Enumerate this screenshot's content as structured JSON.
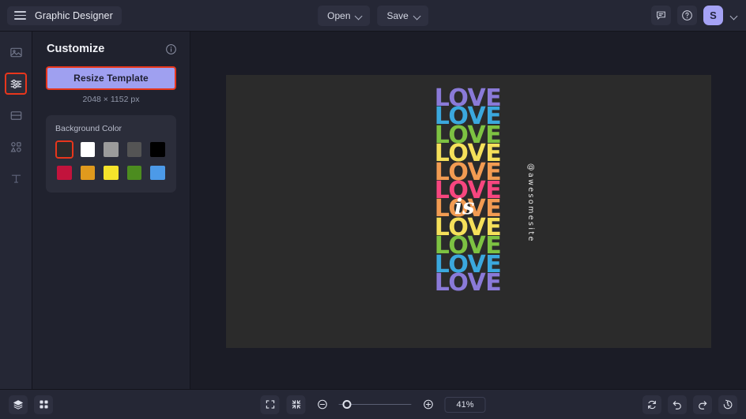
{
  "header": {
    "brand_title": "Graphic Designer",
    "menu_icon": "hamburger-icon",
    "open_label": "Open",
    "save_label": "Save",
    "comment_icon": "comment-icon",
    "help_icon": "help-circle-icon",
    "avatar_initial": "S",
    "avatar_chevron": "chevron-down-icon"
  },
  "rail": {
    "items": [
      {
        "icon": "image-icon",
        "active": false
      },
      {
        "icon": "sliders-icon",
        "active": true
      },
      {
        "icon": "template-layout-icon",
        "active": false
      },
      {
        "icon": "shapes-icon",
        "active": false
      },
      {
        "icon": "text-icon",
        "active": false
      }
    ]
  },
  "panel": {
    "title": "Customize",
    "info_icon": "info-circle-icon",
    "resize_label": "Resize Template",
    "dimensions": "2048 × 1152 px",
    "background_color": {
      "label": "Background Color",
      "swatches": [
        {
          "hex": "#2b2b2b",
          "selected": true
        },
        {
          "hex": "#ffffff",
          "selected": false
        },
        {
          "hex": "#9b9b9b",
          "selected": false
        },
        {
          "hex": "#545454",
          "selected": false
        },
        {
          "hex": "#000000",
          "selected": false
        },
        {
          "hex": "#c2133c",
          "selected": false
        },
        {
          "hex": "#e09a1d",
          "selected": false
        },
        {
          "hex": "#f5e32b",
          "selected": false
        },
        {
          "hex": "#4c8c1f",
          "selected": false
        },
        {
          "hex": "#4c9ae8",
          "selected": false
        }
      ]
    }
  },
  "canvas": {
    "artboard_background": "#2b2b2b",
    "artwork": {
      "word": "LOVE",
      "script_word": "is",
      "handle": "@awesomesite",
      "rows": [
        {
          "text": "LOVE",
          "color": "#8a7ad8"
        },
        {
          "text": "LOVE",
          "color": "#3ba8de"
        },
        {
          "text": "LOVE",
          "color": "#7dc242"
        },
        {
          "text": "LOVE",
          "color": "#f5e05a"
        },
        {
          "text": "LOVE",
          "color": "#f29b52"
        },
        {
          "text": "LOVE",
          "color": "#f7467f"
        },
        {
          "text": "LOVE",
          "color": "#f29b52"
        },
        {
          "text": "LOVE",
          "color": "#f5e05a"
        },
        {
          "text": "LOVE",
          "color": "#7dc242"
        },
        {
          "text": "LOVE",
          "color": "#3ba8de"
        },
        {
          "text": "LOVE",
          "color": "#8a7ad8"
        }
      ]
    }
  },
  "bottom": {
    "layers_icon": "layers-icon",
    "grid_icon": "grid-icon",
    "fit_icon": "fit-screen-icon",
    "shrink_icon": "shrink-to-fit-icon",
    "zoom_out_icon": "zoom-out-icon",
    "zoom_in_icon": "zoom-in-icon",
    "zoom_value": "41%",
    "slider_percent": 8,
    "reset_icon": "reset-icon",
    "undo_icon": "undo-icon",
    "redo_icon": "redo-icon",
    "history_icon": "history-icon"
  }
}
